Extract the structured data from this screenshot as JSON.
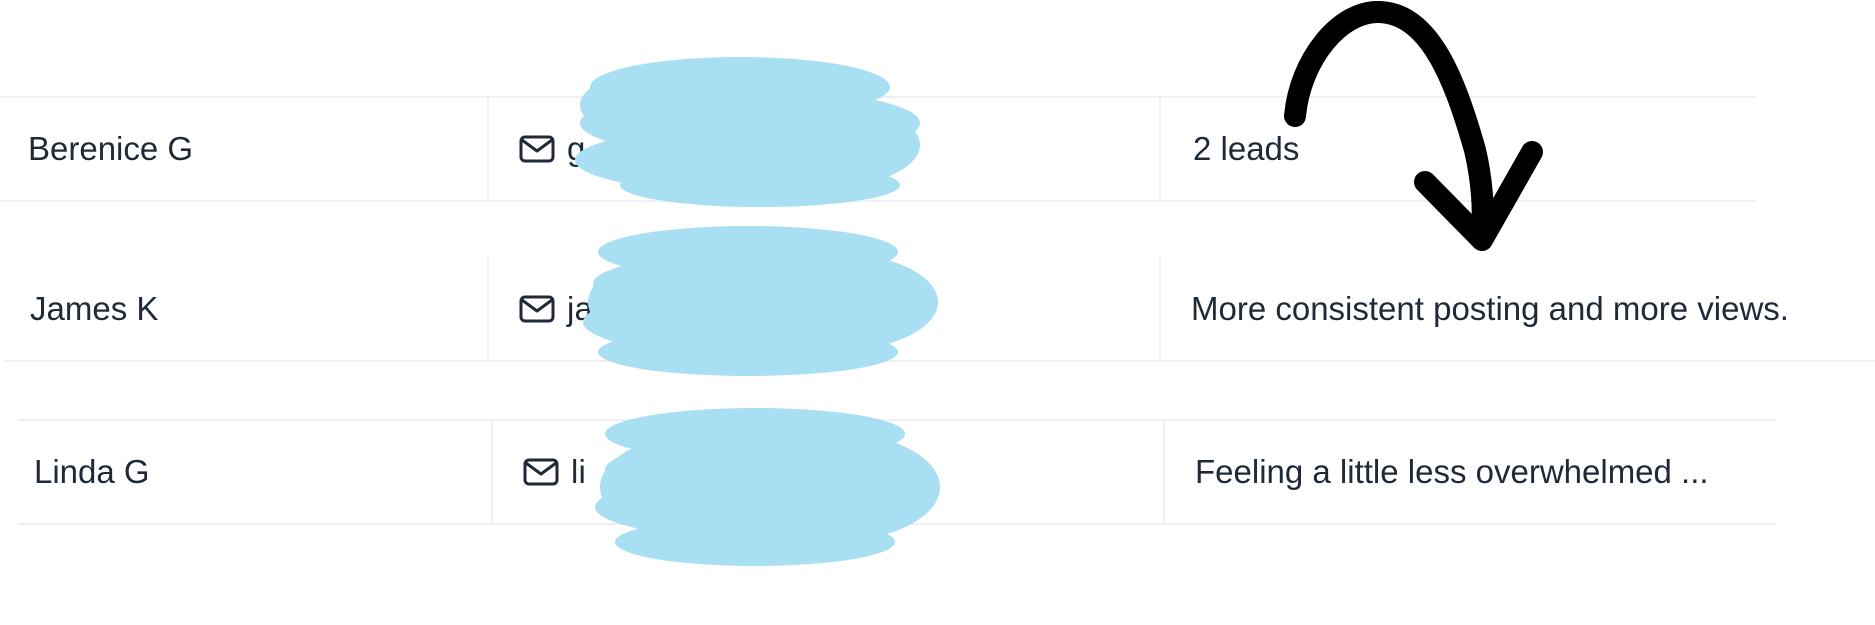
{
  "rows": [
    {
      "name": "Berenice G",
      "email_visible": "g                    .com",
      "note": "2 leads"
    },
    {
      "name": "James K",
      "email_visible": "ja                       ail.com",
      "note": "More consistent posting and more views."
    },
    {
      "name": "Linda G",
      "email_visible": "li                       .com",
      "note": "Feeling a little less overwhelmed ..."
    }
  ],
  "icons": {
    "email": "mail-icon"
  },
  "colors": {
    "redaction": "#a9dff3",
    "arrow": "#000000",
    "divider": "#eef0f3",
    "text": "#1f2937"
  }
}
